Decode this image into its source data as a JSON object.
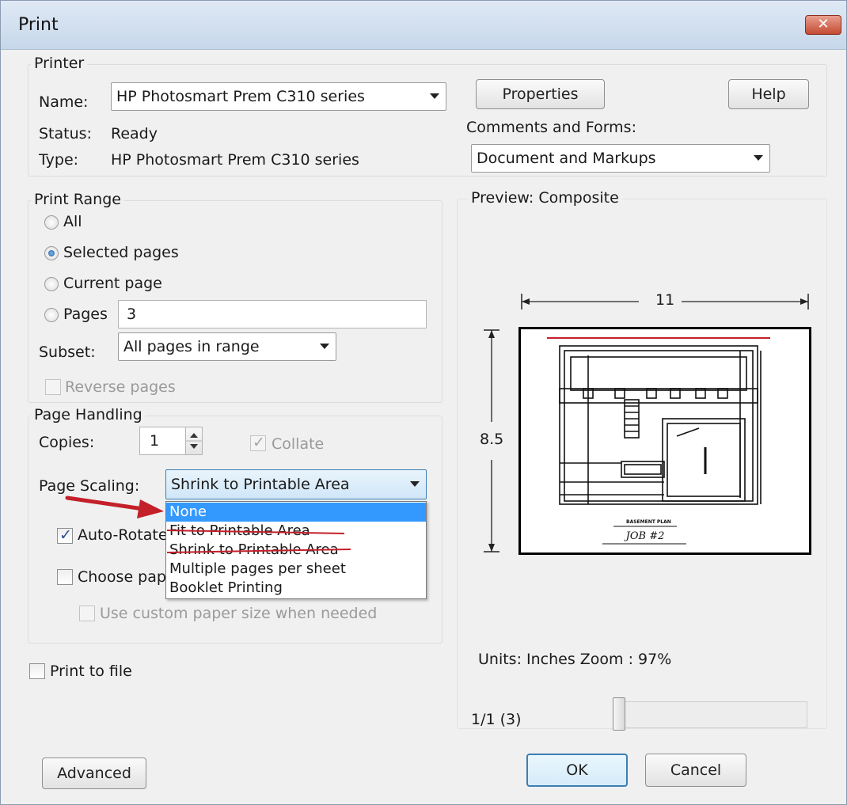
{
  "window": {
    "title": "Print",
    "close_symbol": "✕"
  },
  "printer": {
    "group_label": "Printer",
    "name_label": "Name:",
    "name_value": "HP Photosmart Prem C310 series",
    "status_label": "Status:",
    "status_value": "Ready",
    "type_label": "Type:",
    "type_value": "HP Photosmart Prem C310 series",
    "properties_button": "Properties",
    "help_button": "Help",
    "comments_label": "Comments and Forms:",
    "comments_value": "Document and Markups"
  },
  "print_range": {
    "group_label": "Print Range",
    "all_label": "All",
    "selected_label": "Selected pages",
    "current_label": "Current page",
    "pages_label": "Pages",
    "pages_value": "3",
    "selected_option": "Selected pages",
    "subset_label": "Subset:",
    "subset_value": "All pages in range",
    "reverse_label": "Reverse pages"
  },
  "page_handling": {
    "group_label": "Page Handling",
    "copies_label": "Copies:",
    "copies_value": "1",
    "collate_label": "Collate",
    "collate_checked": true,
    "scaling_label": "Page Scaling:",
    "scaling_value": "Shrink to Printable Area",
    "scaling_options": [
      "None",
      "Fit to Printable Area",
      "Shrink to Printable Area",
      "Multiple pages per sheet",
      "Booklet Printing"
    ],
    "highlighted_option": "None",
    "auto_rotate_label": "Auto-Rotate",
    "auto_rotate_checked": true,
    "choose_paper_label": "Choose pape",
    "choose_paper_checked": false,
    "custom_paper_label": "Use custom paper size when needed"
  },
  "print_to_file": {
    "label": "Print to file",
    "checked": false
  },
  "preview": {
    "label": "Preview: Composite",
    "width_dim": "11",
    "height_dim": "8.5",
    "drawing_caption": "JOB #2",
    "units_zoom": "Units: Inches Zoom :  97%",
    "page_indicator": "1/1 (3)"
  },
  "buttons": {
    "advanced": "Advanced",
    "ok": "OK",
    "cancel": "Cancel"
  },
  "colors": {
    "annotation_red": "#c4202a",
    "selection_blue": "#3399ff"
  }
}
